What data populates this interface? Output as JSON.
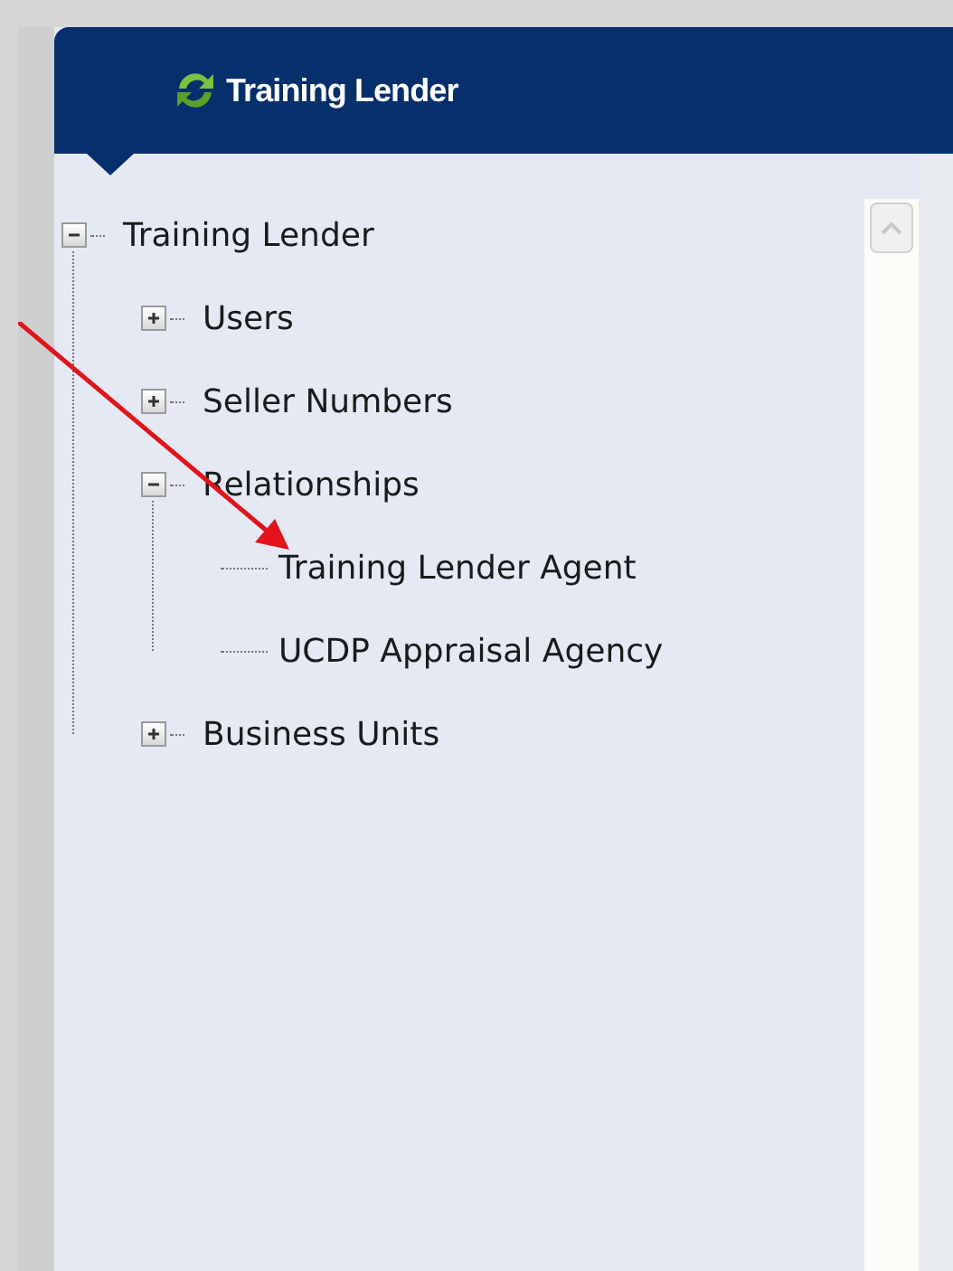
{
  "header": {
    "title": "Training Lender"
  },
  "tree": [
    {
      "label": "Training Lender",
      "expanded": true,
      "children": [
        {
          "label": "Users",
          "expanded": false
        },
        {
          "label": "Seller Numbers",
          "expanded": false
        },
        {
          "label": "Relationships",
          "expanded": true,
          "children": [
            {
              "label": "Training Lender Agent"
            },
            {
              "label": "UCDP Appraisal Agency"
            }
          ]
        },
        {
          "label": "Business Units",
          "expanded": false
        }
      ]
    }
  ]
}
